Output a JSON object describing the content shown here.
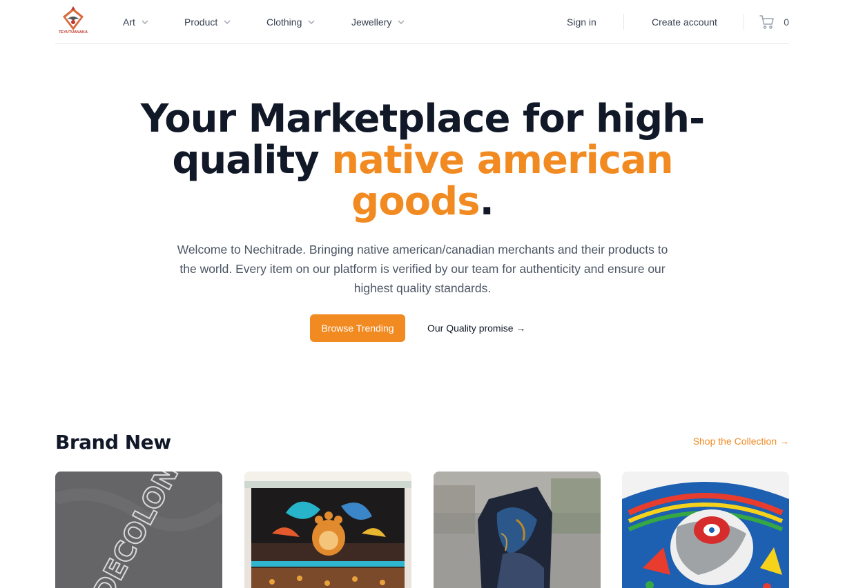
{
  "brand": {
    "logo_text": "TEYUTUANAKA",
    "logo_icon": "eagle-logo-icon"
  },
  "nav": {
    "items": [
      {
        "label": "Art"
      },
      {
        "label": "Product"
      },
      {
        "label": "Clothing"
      },
      {
        "label": "Jewellery"
      }
    ],
    "sign_in": "Sign in",
    "create_account": "Create account",
    "cart_count": "0",
    "cart_icon": "shopping-cart-icon"
  },
  "hero": {
    "title_start": "Your Marketplace for high-quality ",
    "title_accent": "native american goods",
    "title_end": ".",
    "subtitle": "Welcome to Nechitrade. Bringing native american/canadian merchants and their products to the world. Every item on our platform is verified by our team for authenticity and ensure our highest quality standards.",
    "cta_primary": "Browse Trending",
    "cta_secondary": "Our Quality promise →"
  },
  "brand_new": {
    "title": "Brand New",
    "shop_link": "Shop the Collection →",
    "products": [
      {
        "image": "grey-shirt-image",
        "print_text": "DECOLONIZE"
      },
      {
        "image": "floral-beadwork-skirt-image"
      },
      {
        "image": "blue-stone-image"
      },
      {
        "image": "beaded-mask-image"
      }
    ]
  },
  "colors": {
    "accent": "#f28a22",
    "text": "#111827",
    "muted": "#4b5563"
  }
}
